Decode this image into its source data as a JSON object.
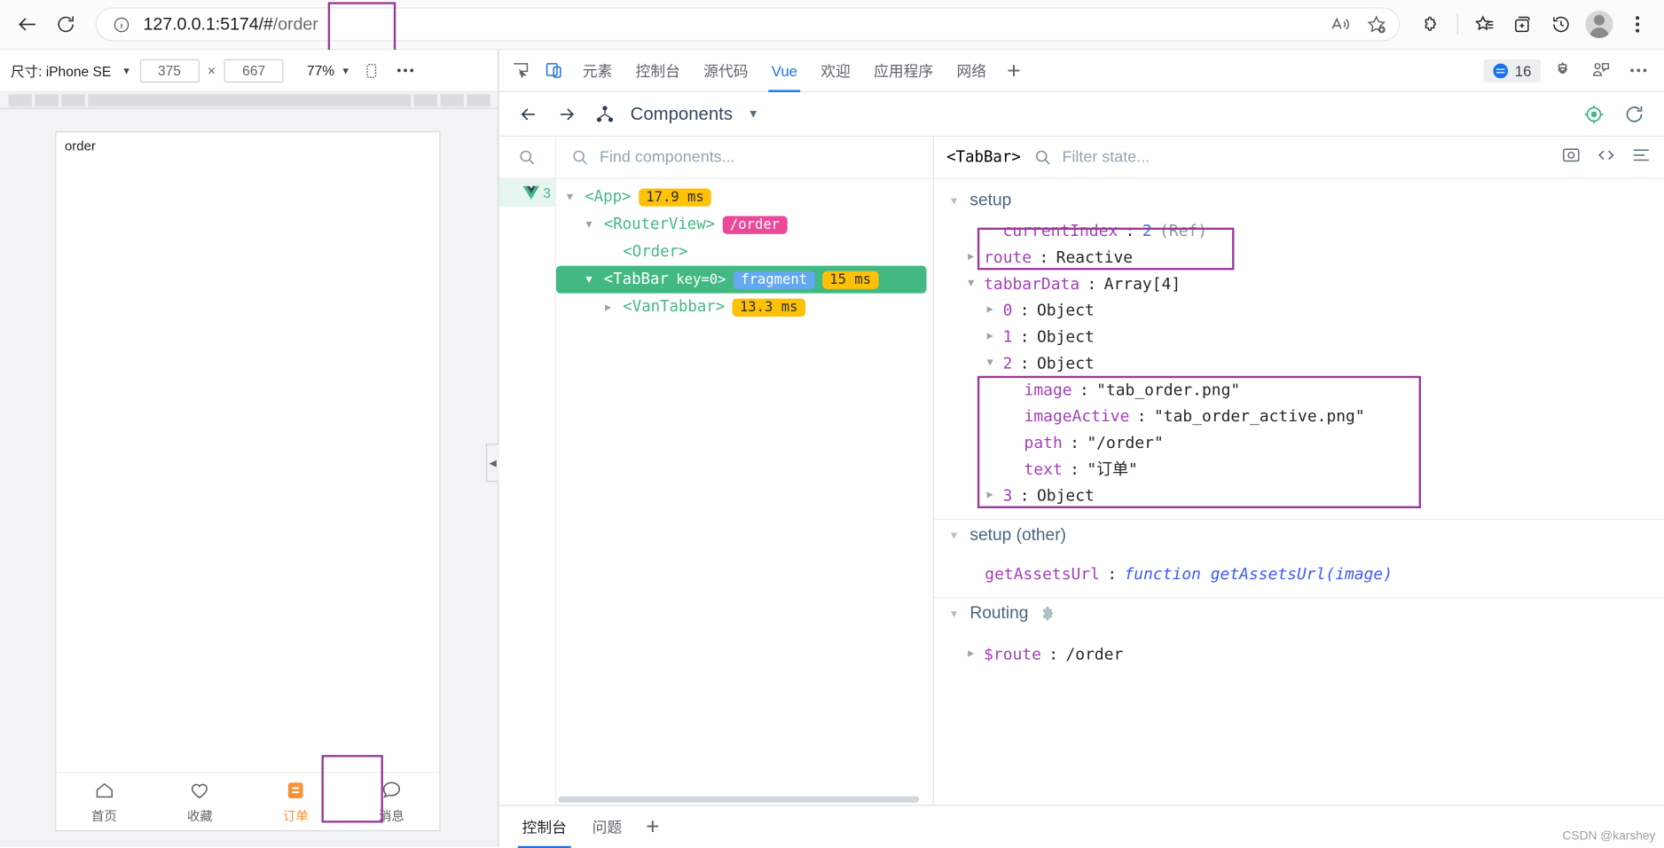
{
  "browser": {
    "back_label": "back-arrow",
    "reload_label": "reload",
    "url_prefix": "127.0.0.1:5174/#",
    "url_suffix": "/order",
    "url_full": "127.0.0.1:5174/#/order",
    "icons": [
      "info-icon",
      "read-aloud-icon",
      "add-favorite-icon",
      "extensions-icon",
      "collections-icon",
      "split-screen-icon",
      "history-icon",
      "profile-icon",
      "settings-more-icon"
    ]
  },
  "device_toolbar": {
    "size_label": "尺寸: iPhone SE",
    "width": "375",
    "multiply": "×",
    "height": "667",
    "zoom": "77%",
    "rotate_icon": "rotate-icon",
    "more_icon": "more-options-icon"
  },
  "phone": {
    "page_title": "order",
    "tabs": [
      {
        "text": "首页",
        "icon": "home-icon",
        "active": false
      },
      {
        "text": "收藏",
        "icon": "heart-icon",
        "active": false
      },
      {
        "text": "订单",
        "icon": "order-icon",
        "active": true
      },
      {
        "text": "消息",
        "icon": "message-icon",
        "active": false
      }
    ],
    "active_color": "#f79239"
  },
  "devtools": {
    "tabs": [
      {
        "label": "元素",
        "selected": false
      },
      {
        "label": "控制台",
        "selected": false
      },
      {
        "label": "源代码",
        "selected": false
      },
      {
        "label": "Vue",
        "selected": true
      },
      {
        "label": "欢迎",
        "selected": false
      },
      {
        "label": "应用程序",
        "selected": false
      },
      {
        "label": "网络",
        "selected": false
      }
    ],
    "add_tab": "+",
    "issues_count": "16",
    "icons": [
      "inspect-icon",
      "device-toolbar-icon",
      "settings-gear-icon",
      "feedback-icon",
      "devtools-more-icon"
    ]
  },
  "vue_panel": {
    "title": "Components",
    "back_icon": "back-arrow-icon",
    "forward_icon": "forward-arrow-icon",
    "component-tree-icon": "components-icon",
    "dropdown_icon": "chevron-down-icon",
    "inspect_icon": "select-component-icon",
    "refresh_icon": "refresh-icon",
    "find_placeholder": "Find components...",
    "filter_placeholder": "Filter state...",
    "selected_component": "<TabBar>",
    "vue_version_badge": "3",
    "tree": [
      {
        "indent": 0,
        "arrow": "▼",
        "tag": "<App>",
        "badge": "17.9 ms",
        "badge_type": "amber",
        "selected": false
      },
      {
        "indent": 1,
        "arrow": "▼",
        "tag": "<RouterView>",
        "badge": "/order",
        "badge_type": "pink",
        "selected": false
      },
      {
        "indent": 2,
        "arrow": "",
        "tag": "<Order>",
        "badge": "",
        "badge_type": "",
        "selected": false
      },
      {
        "indent": 1,
        "arrow": "▼",
        "tag": "<TabBar",
        "key": "key=0>",
        "badge": "fragment",
        "badge_type": "blue",
        "badge2": "15 ms",
        "badge2_type": "amber",
        "selected": true
      },
      {
        "indent": 2,
        "arrow": "▶",
        "tag": "<VanTabbar>",
        "badge": "13.3 ms",
        "badge_type": "amber",
        "selected": false
      }
    ],
    "state": {
      "setup_title": "setup",
      "setup_other_title": "setup (other)",
      "routing_title": "Routing",
      "rows": [
        {
          "arrow": "",
          "key": "currentIndex",
          "sep": ": ",
          "value": "2",
          "value_type": "num",
          "extra": " (Ref)",
          "indent": 1,
          "highlight": true
        },
        {
          "arrow": "▶",
          "key": "route",
          "sep": ": ",
          "value": "Reactive",
          "value_type": "plain",
          "extra": "",
          "indent": 1,
          "highlight": false
        },
        {
          "arrow": "▼",
          "key": "tabbarData",
          "sep": ": ",
          "value": "Array[4]",
          "value_type": "plain",
          "extra": "",
          "indent": 1,
          "highlight": false
        },
        {
          "arrow": "▶",
          "key": "0",
          "sep": ": ",
          "value": "Object",
          "value_type": "plain",
          "extra": "",
          "indent": 2,
          "highlight": false
        },
        {
          "arrow": "▶",
          "key": "1",
          "sep": ": ",
          "value": "Object",
          "value_type": "plain",
          "extra": "",
          "indent": 2,
          "highlight": false
        },
        {
          "arrow": "▼",
          "key": "2",
          "sep": ": ",
          "value": "Object",
          "value_type": "plain",
          "extra": "",
          "indent": 2,
          "highlight": false
        },
        {
          "arrow": "",
          "key": "image",
          "sep": ": ",
          "value": "\"tab_order.png\"",
          "value_type": "str",
          "extra": "",
          "indent": 3,
          "highlight": false
        },
        {
          "arrow": "",
          "key": "imageActive",
          "sep": ": ",
          "value": "\"tab_order_active.png\"",
          "value_type": "str",
          "extra": "",
          "indent": 3,
          "highlight": false
        },
        {
          "arrow": "",
          "key": "path",
          "sep": ": ",
          "value": "\"/order\"",
          "value_type": "str",
          "extra": "",
          "indent": 3,
          "highlight": false
        },
        {
          "arrow": "",
          "key": "text",
          "sep": ": ",
          "value": "\"订单\"",
          "value_type": "str",
          "extra": "",
          "indent": 3,
          "highlight": false
        },
        {
          "arrow": "▶",
          "key": "3",
          "sep": ": ",
          "value": "Object",
          "value_type": "plain",
          "extra": "",
          "indent": 2,
          "highlight": false
        }
      ],
      "other_rows": [
        {
          "key": "getAssetsUrl",
          "sep": ": ",
          "value": "function getAssetsUrl(image)",
          "value_type": "fn"
        }
      ],
      "routing_rows": [
        {
          "arrow": "▶",
          "key": "$route",
          "sep": ": ",
          "value": "/order",
          "value_type": "plain"
        }
      ]
    }
  },
  "drawer": {
    "tabs": [
      {
        "label": "控制台",
        "selected": true
      },
      {
        "label": "问题",
        "selected": false
      }
    ],
    "add": "+"
  },
  "watermark": "CSDN @karshey",
  "colors": {
    "accent_blue": "#1a73e8",
    "vue_green": "#42b883",
    "highlight_purple": "#9c3a99",
    "badge_amber": "#ffc107",
    "badge_pink": "#ec4899",
    "badge_blue": "#64a8f0",
    "tab_active_orange": "#f79239"
  }
}
